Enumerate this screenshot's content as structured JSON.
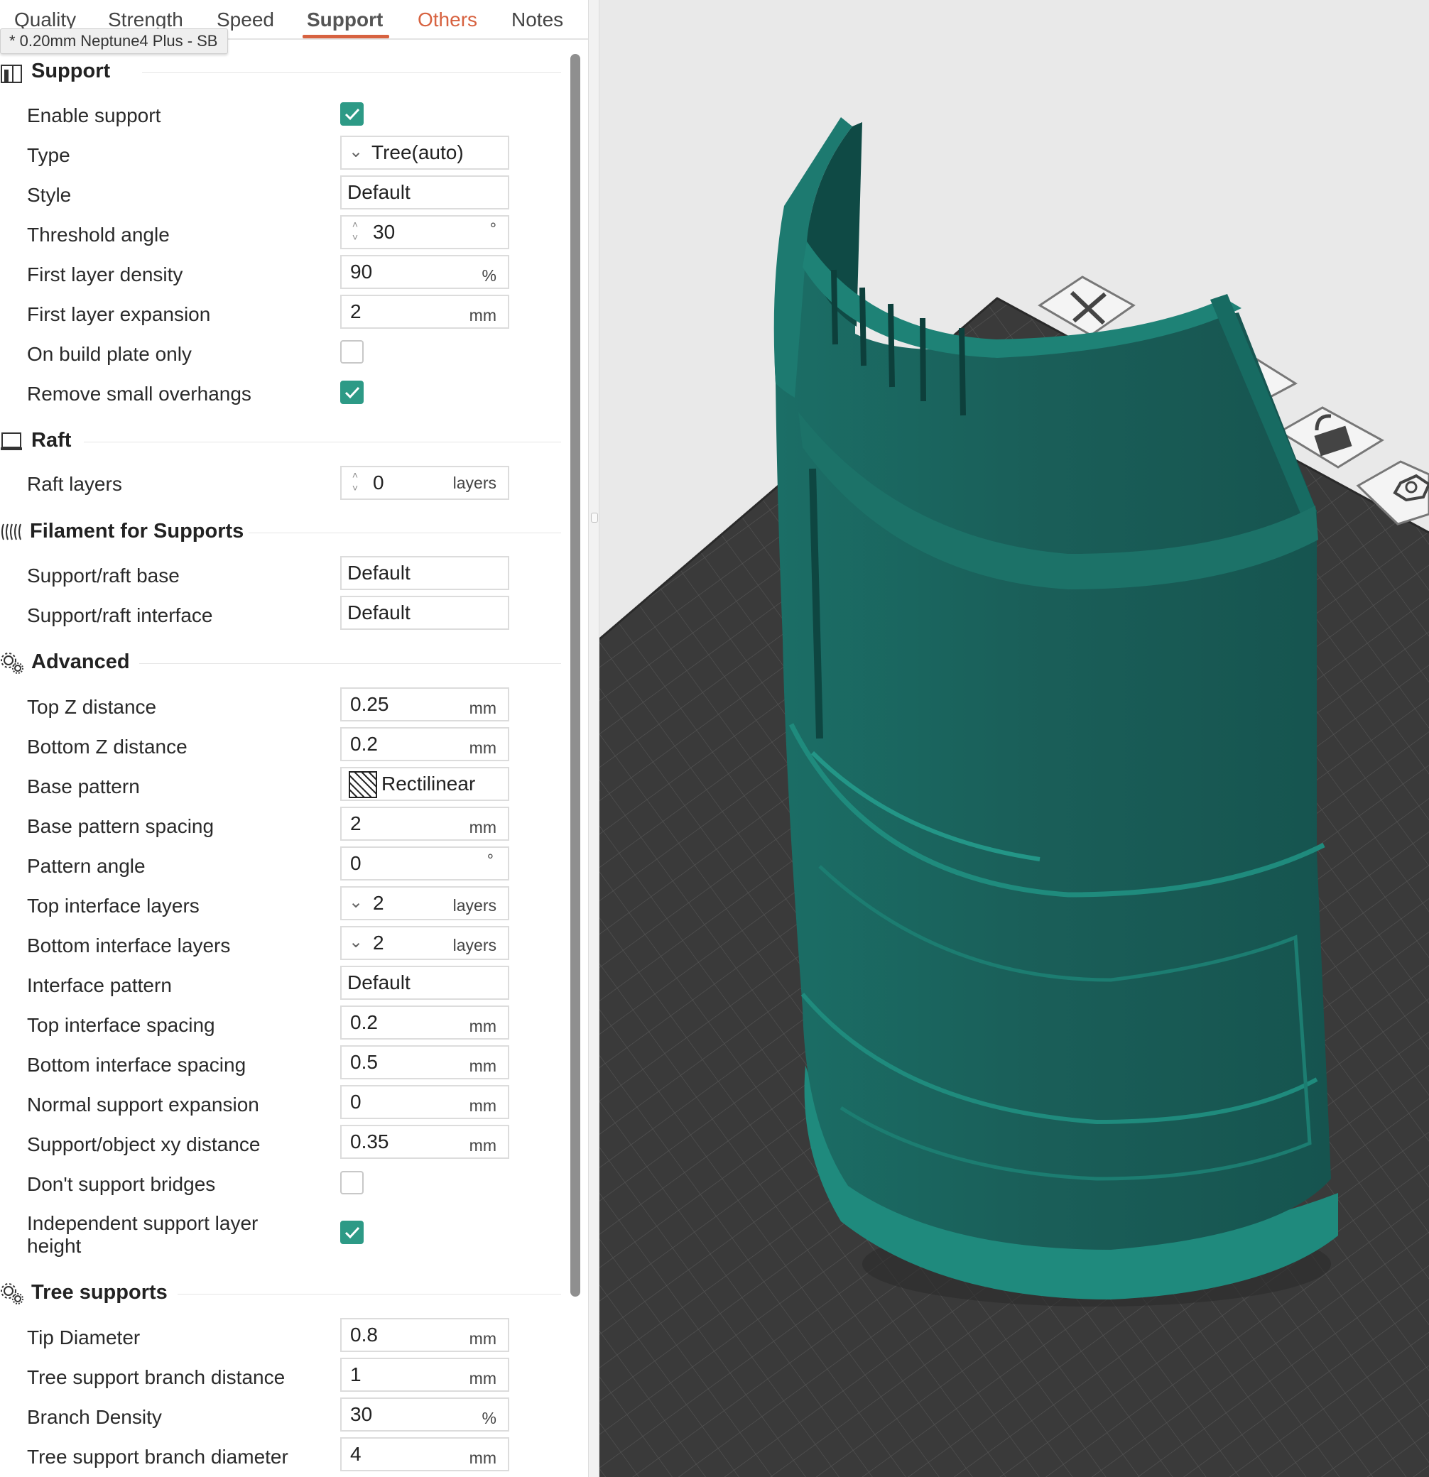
{
  "tabs": [
    {
      "label": "Quality"
    },
    {
      "label": "Strength"
    },
    {
      "label": "Speed"
    },
    {
      "label": "Support"
    },
    {
      "label": "Others"
    },
    {
      "label": "Notes"
    }
  ],
  "preset_tooltip": "* 0.20mm Neptune4 Plus - SB",
  "support": {
    "title": "Support",
    "enable_support": {
      "label": "Enable support",
      "checked": true
    },
    "type": {
      "label": "Type",
      "value": "Tree(auto)"
    },
    "style": {
      "label": "Style",
      "value": "Default"
    },
    "threshold_angle": {
      "label": "Threshold angle",
      "value": "30",
      "unit": "°"
    },
    "first_layer_density": {
      "label": "First layer density",
      "value": "90",
      "unit": "%"
    },
    "first_layer_expansion": {
      "label": "First layer expansion",
      "value": "2",
      "unit": "mm"
    },
    "on_build_plate_only": {
      "label": "On build plate only",
      "checked": false
    },
    "remove_small_overhangs": {
      "label": "Remove small overhangs",
      "checked": true
    }
  },
  "raft": {
    "title": "Raft",
    "raft_layers": {
      "label": "Raft layers",
      "value": "0",
      "unit": "layers"
    }
  },
  "filament": {
    "title": "Filament for Supports",
    "base": {
      "label": "Support/raft base",
      "value": "Default"
    },
    "interface": {
      "label": "Support/raft interface",
      "value": "Default"
    }
  },
  "advanced": {
    "title": "Advanced",
    "top_z": {
      "label": "Top Z distance",
      "value": "0.25",
      "unit": "mm"
    },
    "bottom_z": {
      "label": "Bottom Z distance",
      "value": "0.2",
      "unit": "mm"
    },
    "base_pattern": {
      "label": "Base pattern",
      "value": "Rectilinear"
    },
    "base_pattern_spacing": {
      "label": "Base pattern spacing",
      "value": "2",
      "unit": "mm"
    },
    "pattern_angle": {
      "label": "Pattern angle",
      "value": "0",
      "unit": "°"
    },
    "top_interface_layers": {
      "label": "Top interface layers",
      "value": "2",
      "unit": "layers"
    },
    "bottom_interface_layers": {
      "label": "Bottom interface layers",
      "value": "2",
      "unit": "layers"
    },
    "interface_pattern": {
      "label": "Interface pattern",
      "value": "Default"
    },
    "top_interface_spacing": {
      "label": "Top interface spacing",
      "value": "0.2",
      "unit": "mm"
    },
    "bottom_interface_spacing": {
      "label": "Bottom interface spacing",
      "value": "0.5",
      "unit": "mm"
    },
    "normal_support_expansion": {
      "label": "Normal support expansion",
      "value": "0",
      "unit": "mm"
    },
    "xy_distance": {
      "label": "Support/object xy distance",
      "value": "0.35",
      "unit": "mm"
    },
    "dont_support_bridges": {
      "label": "Don't support bridges",
      "checked": false
    },
    "independent_layer_height": {
      "label": "Independent support layer height",
      "checked": true
    }
  },
  "tree": {
    "title": "Tree supports",
    "tip_diameter": {
      "label": "Tip Diameter",
      "value": "0.8",
      "unit": "mm"
    },
    "branch_distance": {
      "label": "Tree support branch distance",
      "value": "1",
      "unit": "mm"
    },
    "branch_density": {
      "label": "Branch Density",
      "value": "30",
      "unit": "%"
    },
    "branch_diameter": {
      "label": "Tree support branch diameter",
      "value": "4",
      "unit": "mm"
    }
  },
  "colors": {
    "accent": "#d76240",
    "checkbox": "#2d9a86",
    "model": "#1a6b62",
    "plate": "#3a3a3a"
  },
  "viewport_icons": [
    "close-icon",
    "layout-icon",
    "lock-icon",
    "hexagon-icon"
  ]
}
